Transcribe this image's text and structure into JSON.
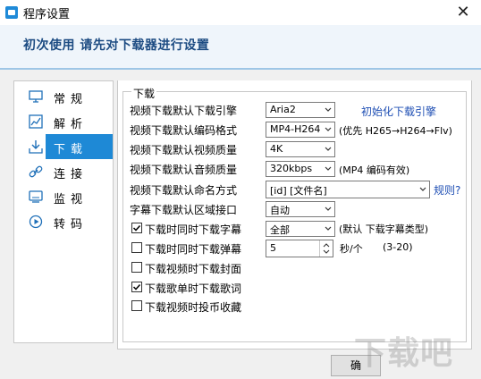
{
  "window": {
    "title": "程序设置",
    "close_glyph": "✕"
  },
  "banner": {
    "text": "初次使用 请先对下载器进行设置"
  },
  "sidebar": {
    "items": [
      {
        "label": "常规",
        "icon": "monitor-icon"
      },
      {
        "label": "解析",
        "icon": "chart-icon"
      },
      {
        "label": "下载",
        "icon": "download-icon",
        "active": true
      },
      {
        "label": "连接",
        "icon": "link-icon"
      },
      {
        "label": "监视",
        "icon": "screen-icon"
      },
      {
        "label": "转码",
        "icon": "play-icon"
      }
    ]
  },
  "download": {
    "group_title": "下载",
    "engine": {
      "label": "视频下载默认下载引擎",
      "value": "Aria2",
      "link": "初始化下载引擎"
    },
    "codec": {
      "label": "视频下载默认编码格式",
      "value": "MP4-H264",
      "note": "(优先 H265→H264→Flv)"
    },
    "quality": {
      "label": "视频下载默认视频质量",
      "value": "4K"
    },
    "audio": {
      "label": "视频下载默认音频质量",
      "value": "320kbps",
      "note": "(MP4 编码有效)"
    },
    "naming": {
      "label": "视频下载默认命名方式",
      "value": "[id] [文件名]",
      "link": "规则?"
    },
    "subtitle_region": {
      "label": "字幕下载默认区域接口",
      "value": "自动"
    },
    "subtitles": {
      "label": "下载时同时下载字幕",
      "checked": true,
      "value": "全部",
      "note": "(默认 下载字幕类型)"
    },
    "danmaku": {
      "label": "下载时同时下载弹幕",
      "checked": false,
      "value": "5",
      "unit": "秒/个",
      "range": "(3-20)"
    },
    "cover": {
      "label": "下载视频时下载封面",
      "checked": false
    },
    "lyrics": {
      "label": "下载歌单时下载歌词",
      "checked": true
    },
    "coin": {
      "label": "下载视频时投币收藏",
      "checked": false
    }
  },
  "footer": {
    "ok_label": "确"
  },
  "watermark": {
    "text": "下载吧"
  },
  "colors": {
    "accent": "#1e89d6",
    "banner_text": "#1c4b82",
    "link": "#1f4fb4"
  }
}
